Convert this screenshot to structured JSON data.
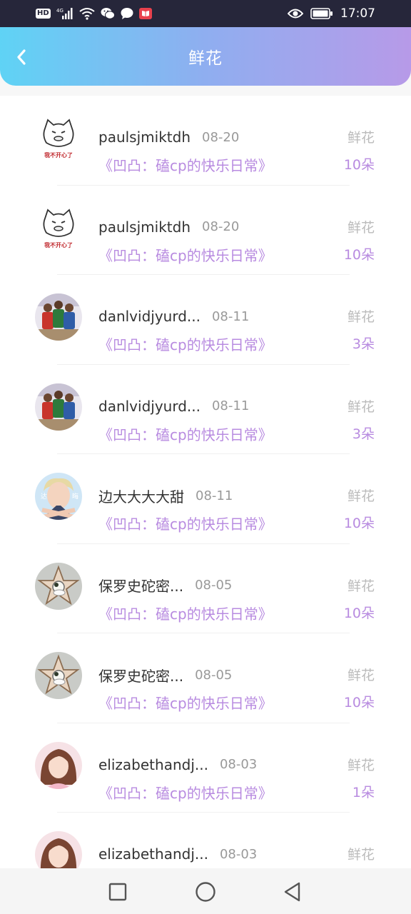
{
  "status_bar": {
    "time": "17:07",
    "hd": "HD",
    "network": "4G",
    "icons": [
      "signal-icon",
      "wifi-icon",
      "wechat-icon",
      "message-icon",
      "book-app-icon",
      "eye-icon",
      "battery-icon"
    ]
  },
  "header": {
    "title": "鲜花",
    "back_icon": "chevron-left-icon"
  },
  "colors": {
    "accent": "#b88be0",
    "gradient_start": "#5fd3f5",
    "gradient_end": "#b79ae8"
  },
  "records": [
    {
      "name": "paulsjmiktdh",
      "date": "08-20",
      "novel": "《凹凸：磕cp的快乐日常》",
      "type": "鲜花",
      "count": "10朵",
      "avatar": "cat-meme",
      "avatar_caption": "我不开心了"
    },
    {
      "name": "paulsjmiktdh",
      "date": "08-20",
      "novel": "《凹凸：磕cp的快乐日常》",
      "type": "鲜花",
      "count": "10朵",
      "avatar": "cat-meme",
      "avatar_caption": "我不开心了"
    },
    {
      "name": "danlvidjyurd...",
      "date": "08-11",
      "novel": "《凹凸：磕cp的快乐日常》",
      "type": "鲜花",
      "count": "3朵",
      "avatar": "basketball"
    },
    {
      "name": "danlvidjyurd...",
      "date": "08-11",
      "novel": "《凹凸：磕cp的快乐日常》",
      "type": "鲜花",
      "count": "3朵",
      "avatar": "basketball"
    },
    {
      "name": "边大大大大甜",
      "date": "08-11",
      "novel": "《凹凸：磕cp的快乐日常》",
      "type": "鲜花",
      "count": "10朵",
      "avatar": "boy"
    },
    {
      "name": "保罗史砣密...",
      "date": "08-05",
      "novel": "《凹凸：磕cp的快乐日常》",
      "type": "鲜花",
      "count": "10朵",
      "avatar": "star"
    },
    {
      "name": "保罗史砣密...",
      "date": "08-05",
      "novel": "《凹凸：磕cp的快乐日常》",
      "type": "鲜花",
      "count": "10朵",
      "avatar": "star"
    },
    {
      "name": "elizabethandj...",
      "date": "08-03",
      "novel": "《凹凸：磕cp的快乐日常》",
      "type": "鲜花",
      "count": "1朵",
      "avatar": "girl"
    },
    {
      "name": "elizabethandj...",
      "date": "08-03",
      "novel": "",
      "type": "鲜花",
      "count": "",
      "avatar": "girl"
    }
  ],
  "nav_bar": {
    "icons": [
      "recents-square-icon",
      "home-circle-icon",
      "back-triangle-icon"
    ]
  }
}
